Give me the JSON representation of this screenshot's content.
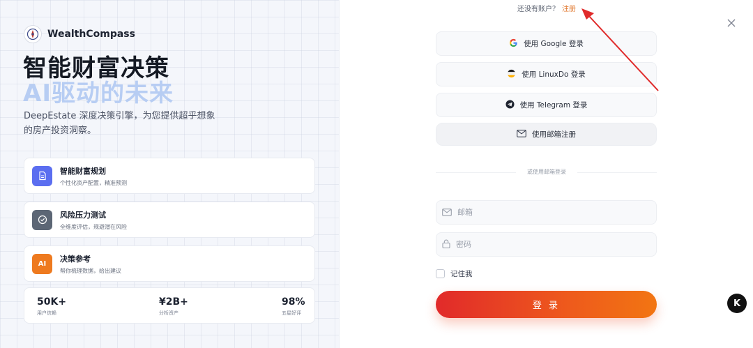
{
  "brand": {
    "name": "WealthCompass"
  },
  "hero": {
    "line1": "智能财富决策",
    "line2": "AI驱动的未来",
    "description": "DeepEstate 深度决策引擎，为您提供超乎想象的房产投资洞察。"
  },
  "features": [
    {
      "title": "智能财富规划",
      "subtitle": "个性化资产配置，精准预测",
      "icon": "document-icon",
      "color": "#5b6ef0",
      "icon_text": ""
    },
    {
      "title": "风险压力测试",
      "subtitle": "全维度评估，规避潜在风险",
      "icon": "check-circle-icon",
      "color": "#5c6675",
      "icon_text": ""
    },
    {
      "title": "决策参考",
      "subtitle": "帮你梳理数据，给出建议",
      "icon": "ai-icon",
      "color": "#ee7a1f",
      "icon_text": "AI"
    }
  ],
  "stats": [
    {
      "value": "50K+",
      "label": "用户信赖"
    },
    {
      "value": "¥2B+",
      "label": "分析资产"
    },
    {
      "value": "98%",
      "label": "五星好评"
    }
  ],
  "auth": {
    "no_account_text": "还没有账户？",
    "register_link": "注册",
    "oauth": {
      "google": "使用 Google 登录",
      "linuxdo": "使用 LinuxDo 登录",
      "telegram": "使用 Telegram 登录",
      "email_register": "使用邮箱注册"
    },
    "divider_text": "或使用邮箱登录",
    "email_placeholder": "邮箱",
    "password_placeholder": "密码",
    "remember_me": "记住我",
    "login_button": "登 录"
  },
  "badge_text": "K",
  "colors": {
    "accent": "#e0762b",
    "login_gradient_start": "#e12a2a",
    "login_gradient_end": "#f27512",
    "arrow": "#e02b2b"
  }
}
